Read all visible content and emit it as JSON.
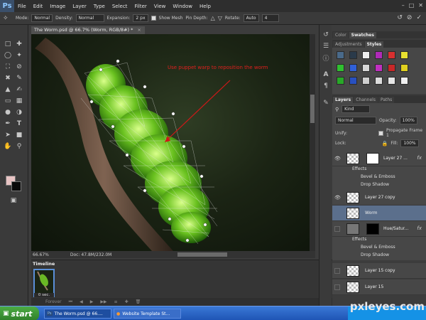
{
  "app": {
    "logo": "Ps"
  },
  "menu": [
    "File",
    "Edit",
    "Image",
    "Layer",
    "Type",
    "Select",
    "Filter",
    "View",
    "Window",
    "Help"
  ],
  "options": {
    "mode_label": "Mode:",
    "mode_value": "Normal",
    "density_label": "Density:",
    "density_value": "Normal",
    "expansion_label": "Expansion:",
    "expansion_value": "2 px",
    "show_mesh_label": "Show Mesh",
    "pin_depth_label": "Pin Depth:",
    "rotate_label": "Rotate:",
    "rotate_value": "Auto",
    "rotate_degrees": "4"
  },
  "document": {
    "tab_title": "The Worm.psd @ 66.7% (Worm, RGB/8#) *",
    "annotation": "Use puppet warp to reposition the worm",
    "zoom": "66.67%",
    "doc_info": "Doc: 47.8M/232.0M"
  },
  "timeline": {
    "title": "Timeline",
    "frame_time": "0 sec.",
    "loop": "Forever"
  },
  "color_panel": {
    "tabs": [
      "Color",
      "Swatches"
    ]
  },
  "styles_panel": {
    "tabs": [
      "Adjustments",
      "Styles"
    ]
  },
  "layers_panel": {
    "tabs": [
      "Layers",
      "Channels",
      "Paths"
    ],
    "filter_kind": "Kind",
    "blend_mode": "Normal",
    "opacity_label": "Opacity:",
    "opacity_value": "100%",
    "unify_label": "Unify:",
    "propagate_label": "Propagate Frame 1",
    "lock_label": "Lock:",
    "fill_label": "Fill:",
    "fill_value": "100%",
    "layers": [
      {
        "name": "Layer 27 ...",
        "fx": "fx"
      },
      {
        "name": "Layer 27 copy"
      },
      {
        "name": "Worm"
      },
      {
        "name": "Hue/Satur...",
        "fx": "fx"
      },
      {
        "name": "Layer 15 copy"
      },
      {
        "name": "Layer 15"
      }
    ],
    "effects_a": [
      "Effects",
      "Bevel & Emboss",
      "Drop Shadow"
    ],
    "effects_b": [
      "Effects",
      "Bevel & Emboss",
      "Drop Shadow"
    ]
  },
  "taskbar": {
    "start": "start",
    "items": [
      "The Worm.psd @ 66....",
      "Website Template St..."
    ]
  },
  "watermark": "pxleyes.com",
  "colors": {
    "foreground": "#e8c4c4",
    "background": "#0a0a0a"
  }
}
